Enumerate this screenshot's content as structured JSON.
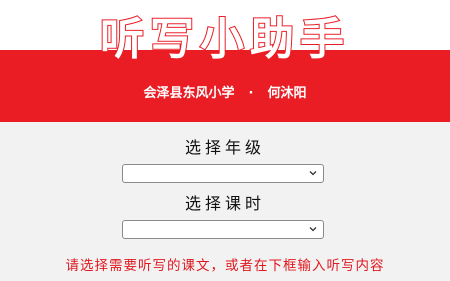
{
  "header": {
    "title": "听写小助手",
    "school": "会泽县东风小学",
    "separator": "·",
    "author": "何沐阳"
  },
  "form": {
    "text_label": "选择年级",
    "text_select_value": "",
    "lesson_label": "选择课时",
    "lesson_select_value": ""
  },
  "hint": "请选择需要听写的课文，或者在下框输入听写内容",
  "colors": {
    "brand_red": "#ea1c24",
    "background": "#f2f2f2"
  }
}
